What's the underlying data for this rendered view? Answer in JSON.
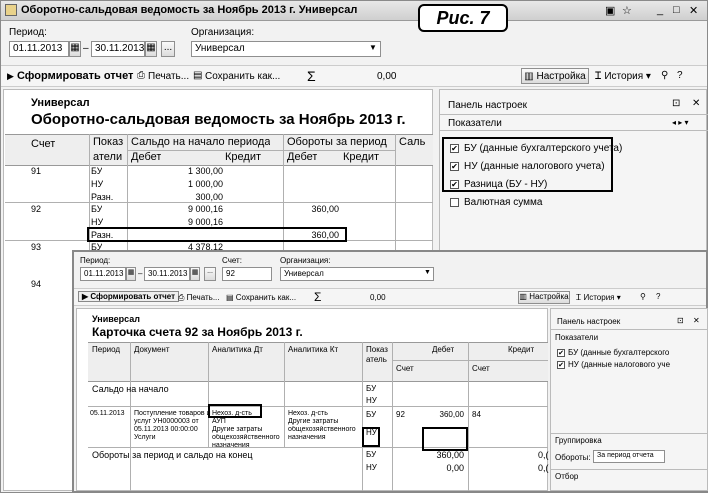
{
  "w1": {
    "title": "Оборотно-сальдовая ведомость за Ноябрь 2013 г. Универсал",
    "period_label": "Период:",
    "date_from": "01.11.2013",
    "dash": "–",
    "date_to": "30.11.2013",
    "org_label": "Организация:",
    "org_value": "Универсал",
    "toolbar": {
      "generate": "Сформировать отчет",
      "print": "Печать...",
      "save": "Сохранить как...",
      "sigma": "Σ",
      "sum": "0,00",
      "settings": "Настройка",
      "history": "История"
    },
    "report_org": "Универсал",
    "report_title": "Оборотно-сальдовая ведомость за Ноябрь 2013 г.",
    "headers": {
      "account": "Счет",
      "indicator_1": "Показ",
      "indicator_2": "атели",
      "balance_start": "Сальдо на начало периода",
      "turnover": "Обороты за период",
      "balance_end": "Саль",
      "debit": "Дебет",
      "credit": "Кредит",
      "debit2": "Дебет",
      "credit2": "Кредит"
    },
    "rows": [
      {
        "acc": "91",
        "ind": "БУ",
        "deb": "1 300,00",
        "tdeb": ""
      },
      {
        "acc": "",
        "ind": "НУ",
        "deb": "1 000,00",
        "tdeb": ""
      },
      {
        "acc": "",
        "ind": "Разн.",
        "deb": "300,00",
        "tdeb": ""
      },
      {
        "acc": "92",
        "ind": "БУ",
        "deb": "9 000,16",
        "tdeb": "360,00"
      },
      {
        "acc": "",
        "ind": "НУ",
        "deb": "9 000,16",
        "tdeb": ""
      },
      {
        "acc": "",
        "ind": "Разн.",
        "deb": "",
        "tdeb": "360,00"
      },
      {
        "acc": "93",
        "ind": "БУ",
        "deb": "4 378,12",
        "tdeb": ""
      },
      {
        "acc": "94",
        "ind": "",
        "deb": "",
        "tdeb": ""
      }
    ],
    "panel": {
      "title": "Панель настроек",
      "section": "Показатели",
      "nav": "◂ ▸ ▾",
      "items": [
        {
          "label": "БУ (данные бухгалтерского учета)",
          "checked": true
        },
        {
          "label": "НУ (данные налогового учета)",
          "checked": true
        },
        {
          "label": "Разница (БУ - НУ)",
          "checked": true
        },
        {
          "label": "Валютная сумма",
          "checked": false
        }
      ]
    }
  },
  "caption": "Рис. 7",
  "w2": {
    "period_label": "Период:",
    "date_from": "01.11.2013",
    "dash": "–",
    "date_to": "30.11.2013",
    "account_label": "Счет:",
    "account_value": "92",
    "org_label": "Организация:",
    "org_value": "Универсал",
    "toolbar": {
      "generate": "Сформировать отчет",
      "print": "Печать...",
      "save": "Сохранить как...",
      "sigma": "Σ",
      "sum": "0,00",
      "settings": "Настройка",
      "history": "История"
    },
    "report_org": "Универсал",
    "report_title": "Карточка счета 92 за Ноябрь 2013 г.",
    "headers": {
      "period": "Период",
      "document": "Документ",
      "an_dt": "Аналитика Дт",
      "an_kt": "Аналитика Кт",
      "ind_1": "Показ",
      "ind_2": "атель",
      "debit": "Дебет",
      "credit": "Кредит",
      "acc": "Счет",
      "acc2": "Счет"
    },
    "opening": {
      "label": "Сальдо на начало",
      "bu": "БУ",
      "nu": "НУ"
    },
    "entry": {
      "date": "05.11.2013",
      "doc_1": "Поступление товаров и",
      "doc_2": "услуг УН0000003 от",
      "doc_3": "05.11.2013 00:00:00",
      "doc_4": "Услуги",
      "dt_1": "Нехоз. д-сть",
      "dt_2": "АУП",
      "dt_3": "Другие затраты",
      "dt_4": "общехозяйственного",
      "dt_5": "назначения",
      "kt_1": "Нехоз. д-сть",
      "kt_2": "Другие затраты",
      "kt_3": "общехозяйственного",
      "kt_4": "назначения",
      "ind_bu": "БУ",
      "ind_nu": "НУ",
      "acc": "92",
      "amount": "360,00",
      "acc_kt": "84"
    },
    "closing": {
      "label": "Обороты за период и сальдо на конец",
      "bu": "БУ",
      "nu": "НУ",
      "bu_val": "360,00",
      "nu_val": "0,00",
      "bu_cr": "0,(",
      "nu_cr": "0,("
    },
    "panel": {
      "title": "Панель настроек",
      "section": "Показатели",
      "items": [
        {
          "label": "БУ (данные бухгалтерского",
          "checked": true
        },
        {
          "label": "НУ (данные налогового уче",
          "checked": true
        }
      ],
      "grouping": "Группировка",
      "turnover_label": "Обороты:",
      "turnover_value": "За период отчета",
      "selection": "Отбор"
    }
  }
}
